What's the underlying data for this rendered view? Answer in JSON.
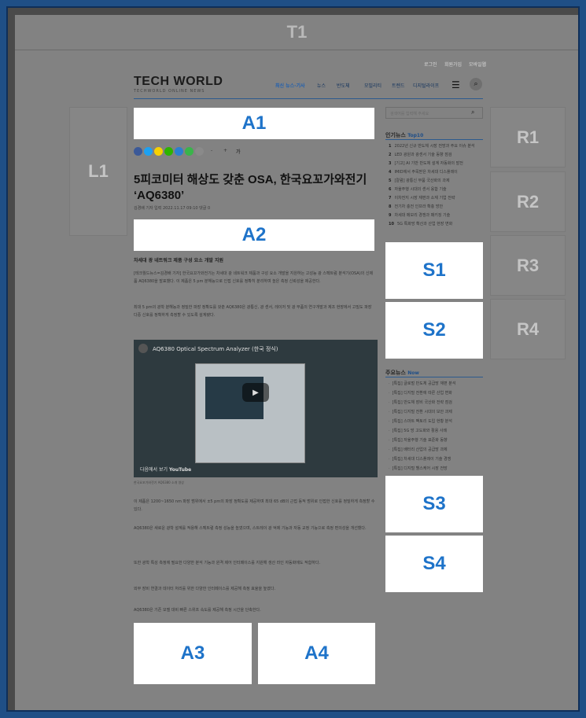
{
  "ads": {
    "t1": "T1",
    "a1": "A1",
    "a2": "A2",
    "a3": "A3",
    "a4": "A4",
    "l1": "L1",
    "r1": "R1",
    "r2": "R2",
    "r3": "R3",
    "r4": "R4",
    "s1": "S1",
    "s2": "S2",
    "s3": "S3",
    "s4": "S4"
  },
  "utility_links": [
    "로그인",
    "회원가입",
    "모바일웹"
  ],
  "logo": {
    "text": "TECH WORLD",
    "tagline": "TECHWORLD ONLINE NEWS"
  },
  "nav": {
    "items": [
      "최신 뉴스·기사",
      "뉴스",
      "반도체",
      "모빌리티",
      "트렌드",
      "디지털라이프"
    ]
  },
  "article": {
    "font_controls": [
      "-",
      "+",
      "가"
    ],
    "headline": "5피코미터 해상도 갖춘 OSA, 한국요꼬가와전기 ‘AQ6380’",
    "meta": "김경배 기자   입력 2022.11.17 09:10   댓글 0",
    "subhead": "차세대 광 네트워크 제품 구성 요소 개발 지원",
    "paragraphs": [
      "[테크월드뉴스=김경배 기자] 한국요꼬가와전기는 차세대 광 네트워크 제품과 구성 요소 개발을 지원하는 고성능 광 스펙트럼 분석기(OSA)의 신제품 AQ6380을 발표했다. 이 제품은 5 pm 분해능으로 인접 신호를 정확히 분리하며 높은 측정 신뢰성을 제공한다.",
      "최대 5 pm의 광학 분해능과 정밀한 파장 정확도를 갖춘 AQ6380은 광통신, 광 센서, 레이저 및 광 부품의 연구개발과 제조 현장에서 고밀도 파장 다중 신호를 정확하게 측정할 수 있도록 설계됐다.",
      "이 제품은 1200~1650 nm 파장 범위에서 ±5 pm의 파장 정확도를 제공하며 최대 65 dB의 근접 동적 범위로 인접한 신호를 정밀하게 측정할 수 있다.",
      "AQ6380은 새로운 광학 설계를 적용해 스펙트럼 측정 성능을 높였으며, 스트레이 광 억제 기능과 자동 교정 기능으로 측정 편의성을 개선했다.",
      "또한 광학 특성 측정에 필요한 다양한 분석 기능과 원격 제어 인터페이스를 지원해 생산 라인 자동화에도 적합하다.",
      "외부 장비 연결과 데이터 처리를 위한 다양한 인터페이스를 제공해 측정 효율을 높였다.",
      "AQ6380은 기존 모델 대비 빠른 스위프 속도를 제공해 측정 시간을 단축한다."
    ],
    "video": {
      "title": "AQ6380 Optical Spectrum Analyzer (한국 정식)",
      "watch_label": "다음에서 보기",
      "platform": "YouTube"
    },
    "caption": "한국요꼬가와전기 AQ6380 소개 영상"
  },
  "sidebar": {
    "search_placeholder": "검색어를 입력해 주세요",
    "popular": {
      "title": "인기뉴스",
      "tag": "Top10",
      "items": [
        "2022년 신규 반도체 시장 전망과 주요 이슈 분석",
        "LED 광원과 광센서 기술 동향 점검",
        "[기고] AI 기반 반도체 설계 자동화의 발전",
        "IMID에서 주목받은 차세대 디스플레이",
        "[칼럼] 광통신 부품 국산화의 과제",
        "자율주행 시대의 센서 융합 기술",
        "이차전지 시장 재편과 소재 기업 전략",
        "전기차 충전 인프라 확충 방안",
        "차세대 메모리 경쟁과 패키징 기술",
        "5G 특화망 확산과 산업 현장 변화"
      ]
    },
    "main_news": {
      "title": "주요뉴스",
      "tag": "Now",
      "items": [
        "[특집] 글로벌 반도체 공급망 재편 분석",
        "[특집] 디지털 전환에 따른 산업 변화",
        "[특집] 반도체 장비 국산화 전략 점검",
        "[특집] 디지털 전환 시대의 보안 과제",
        "[특집] 스마트 팩토리 도입 현황 분석",
        "[특집] 5G 망 고도화와 활용 사례",
        "[특집] 자율주행 기술 표준화 동향",
        "[특집] 배터리 산업의 공급망 과제",
        "[특집] 차세대 디스플레이 기술 경쟁",
        "[특집] 디지털 헬스케어 시장 전망"
      ]
    }
  }
}
